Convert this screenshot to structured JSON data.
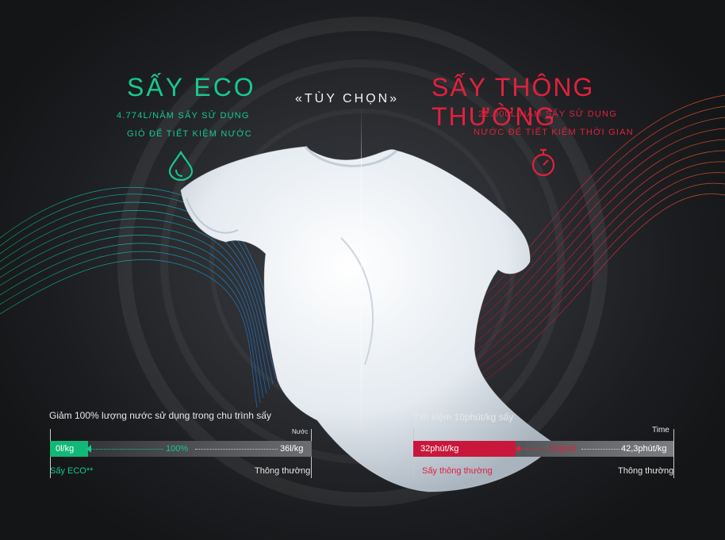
{
  "left": {
    "title": "SẤY ECO",
    "line1": "4.774L/NĂM SẤY SỬ DỤNG",
    "line2": "GIÓ ĐỂ TIẾT KIỆM NƯỚC",
    "icon": "water-drop-icon",
    "caption": "Giảm 100% lượng nước sử dụng trong chu trình sấy",
    "unit": "Nước",
    "bar": {
      "eco_value": "0l/kg",
      "percent": "100%",
      "normal_value": "36l/kg",
      "eco_fraction": 0.0,
      "label_eco": "Sấy ECO**",
      "label_normal": "Thông thường"
    },
    "accent": "#17c98c"
  },
  "center": {
    "title": "«TÙY CHỌN»"
  },
  "right": {
    "title": "SẤY THÔNG THƯỜNG",
    "line1": "22.000L/NĂM SẤY SỬ DỤNG",
    "line2": "NƯỚC ĐỂ TIẾT KIỆM THỜI GIAN",
    "icon": "stopwatch-icon",
    "caption": "Tiết kiệm 10phút/kg sấy",
    "unit": "Time",
    "bar": {
      "fast_value": "32phút/kg",
      "saving": "10phút",
      "slow_value": "42,3phút/kg",
      "label_fast": "Sấy thông thường",
      "label_slow": "Thông thường"
    },
    "accent": "#e0213e"
  }
}
